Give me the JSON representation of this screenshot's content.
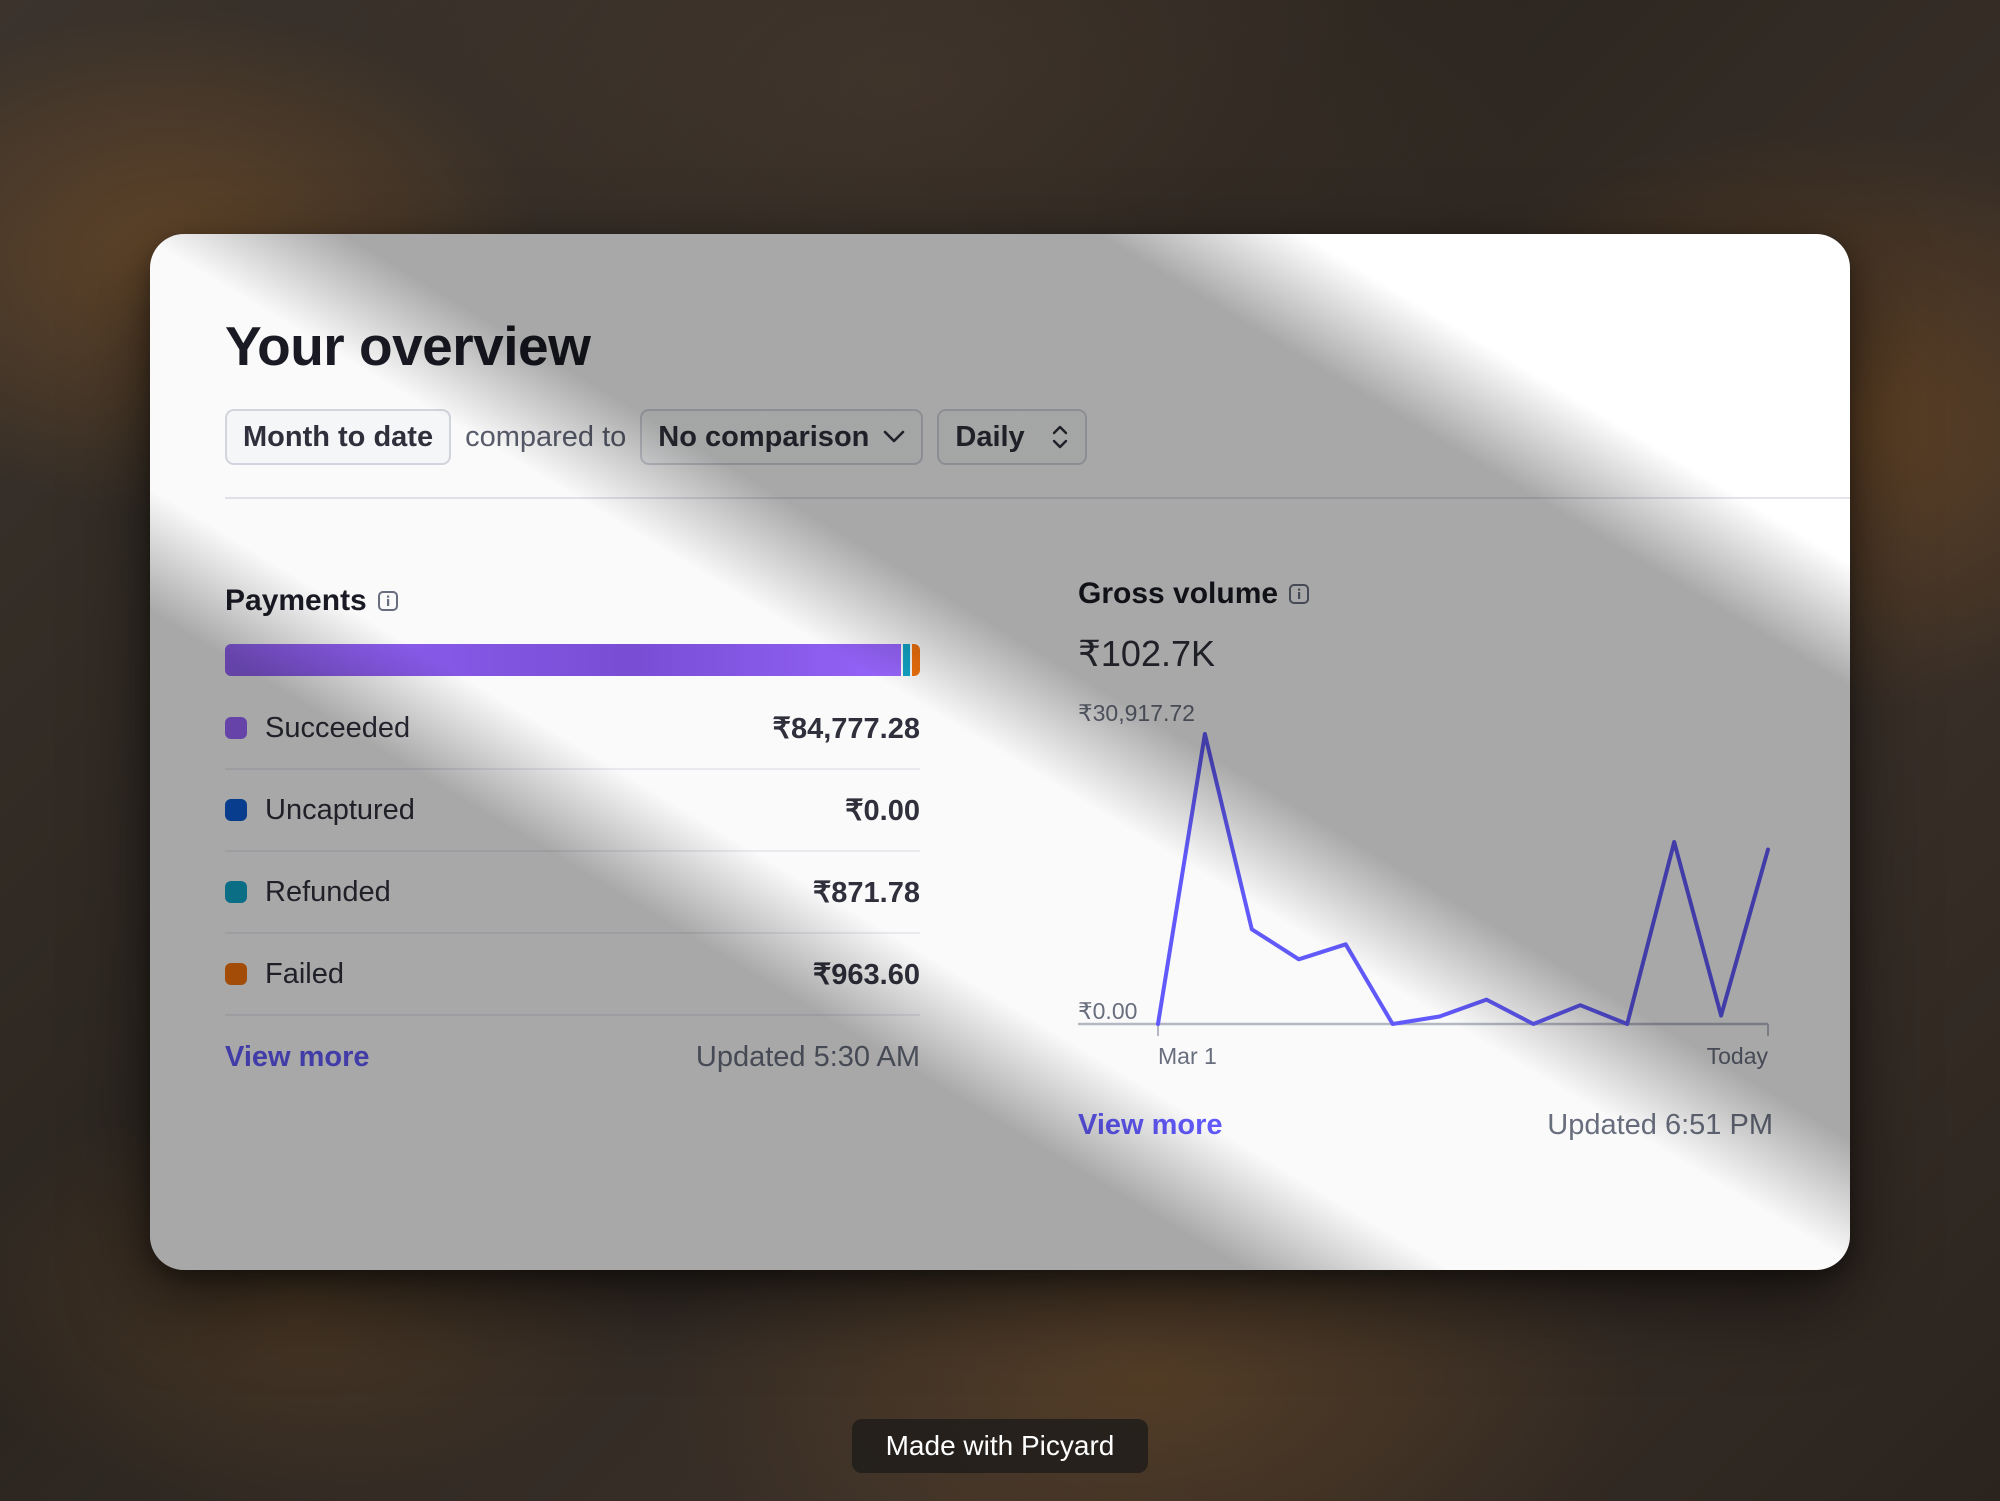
{
  "overview": {
    "title": "Your overview",
    "date_range": "Month to date",
    "compared_to_label": "compared to",
    "comparison": "No comparison",
    "interval": "Daily"
  },
  "payments": {
    "title": "Payments",
    "breakdown": [
      {
        "label": "Succeeded",
        "value": "₹84,777.28",
        "amount": 84777.28,
        "color": "#9966ff"
      },
      {
        "label": "Uncaptured",
        "value": "₹0.00",
        "amount": 0,
        "color": "#0b5cd5"
      },
      {
        "label": "Refunded",
        "value": "₹871.78",
        "amount": 871.78,
        "color": "#12a7c9"
      },
      {
        "label": "Failed",
        "value": "₹963.60",
        "amount": 963.6,
        "color": "#f5730c"
      }
    ],
    "view_more": "View more",
    "updated": "Updated 5:30 AM"
  },
  "gross_volume": {
    "title": "Gross volume",
    "total": "₹102.7K",
    "view_more": "View more",
    "updated": "Updated 6:51 PM"
  },
  "chart_data": {
    "type": "line",
    "ytick_top": "₹30,917.72",
    "ytick_bottom": "₹0.00",
    "xtick_start": "Mar 1",
    "xtick_end": "Today",
    "ylim": [
      0,
      30917.72
    ],
    "series": [
      {
        "values": [
          0,
          30917.72,
          10100,
          6900,
          8500,
          0,
          800,
          2600,
          0,
          2000,
          0,
          19400,
          900,
          18600
        ]
      }
    ],
    "line_color": "#635bff"
  },
  "watermark": "Made with Picyard"
}
